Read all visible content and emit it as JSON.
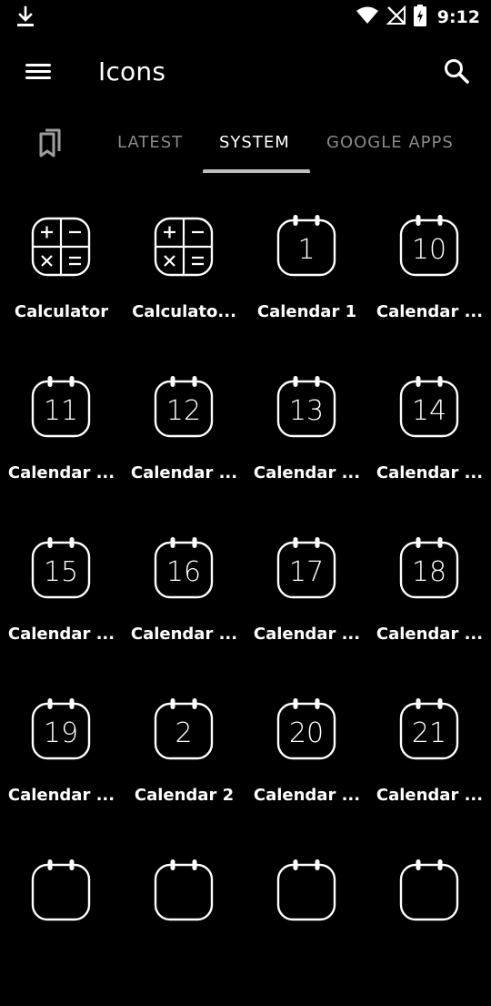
{
  "status_bar": {
    "time": "9:12",
    "icons": [
      "download-icon",
      "wifi-icon",
      "signal-off-icon",
      "battery-charging-icon"
    ]
  },
  "app_bar": {
    "title": "Icons",
    "menu_icon": "hamburger-menu-icon",
    "search_icon": "search-icon"
  },
  "tabs": [
    {
      "label": "LATEST",
      "active": false
    },
    {
      "label": "SYSTEM",
      "active": true
    },
    {
      "label": "GOOGLE APPS",
      "active": false
    }
  ],
  "icons": [
    {
      "label": "Calculator",
      "glyph": "calc",
      "num": ""
    },
    {
      "label": "Calculato...",
      "glyph": "calc",
      "num": ""
    },
    {
      "label": "Calendar 1",
      "glyph": "cal",
      "num": "1"
    },
    {
      "label": "Calendar ...",
      "glyph": "cal",
      "num": "10"
    },
    {
      "label": "Calendar ...",
      "glyph": "cal",
      "num": "11"
    },
    {
      "label": "Calendar ...",
      "glyph": "cal",
      "num": "12"
    },
    {
      "label": "Calendar ...",
      "glyph": "cal",
      "num": "13"
    },
    {
      "label": "Calendar ...",
      "glyph": "cal",
      "num": "14"
    },
    {
      "label": "Calendar ...",
      "glyph": "cal",
      "num": "15"
    },
    {
      "label": "Calendar ...",
      "glyph": "cal",
      "num": "16"
    },
    {
      "label": "Calendar ...",
      "glyph": "cal",
      "num": "17"
    },
    {
      "label": "Calendar ...",
      "glyph": "cal",
      "num": "18"
    },
    {
      "label": "Calendar ...",
      "glyph": "cal",
      "num": "19"
    },
    {
      "label": "Calendar 2",
      "glyph": "cal",
      "num": "2"
    },
    {
      "label": "Calendar ...",
      "glyph": "cal",
      "num": "20"
    },
    {
      "label": "Calendar ...",
      "glyph": "cal",
      "num": "21"
    },
    {
      "label": "",
      "glyph": "cal",
      "num": ""
    },
    {
      "label": "",
      "glyph": "cal",
      "num": ""
    },
    {
      "label": "",
      "glyph": "cal",
      "num": ""
    },
    {
      "label": "",
      "glyph": "cal",
      "num": ""
    }
  ]
}
